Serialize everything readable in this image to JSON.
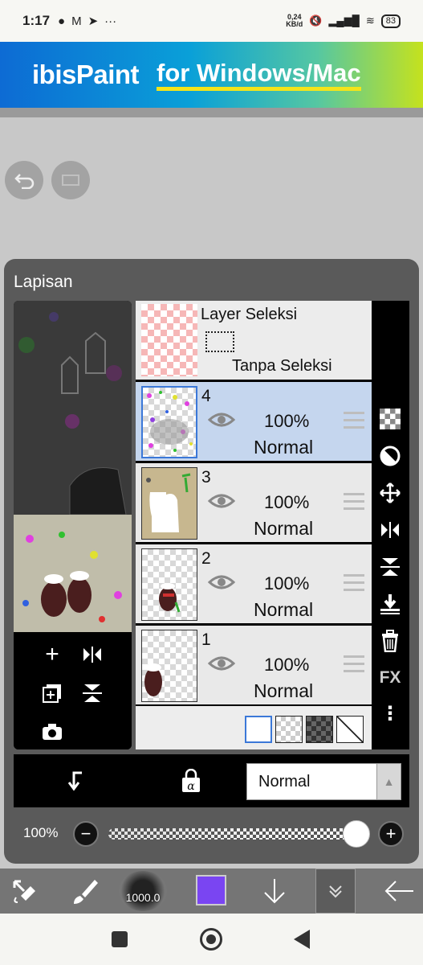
{
  "status_bar": {
    "time": "1:17",
    "net_speed_value": "0,24",
    "net_speed_unit": "KB/d",
    "battery": "83",
    "more": "···"
  },
  "banner": {
    "logo": "ibisPaint",
    "subtitle": "for Windows/Mac"
  },
  "layer_panel": {
    "title": "Lapisan",
    "selection_layer": {
      "title": "Layer Seleksi",
      "status": "Tanpa Seleksi"
    },
    "layers": [
      {
        "number": "4",
        "opacity": "100%",
        "blend": "Normal",
        "selected": true
      },
      {
        "number": "3",
        "opacity": "100%",
        "blend": "Normal",
        "selected": false
      },
      {
        "number": "2",
        "opacity": "100%",
        "blend": "Normal",
        "selected": false
      },
      {
        "number": "1",
        "opacity": "100%",
        "blend": "Normal",
        "selected": false
      }
    ],
    "side_toolbar": {
      "fx_label": "FX",
      "more": "⋮"
    }
  },
  "blend_bar": {
    "mode": "Normal"
  },
  "opacity_control": {
    "label": "100%",
    "value": 1.0,
    "minus": "−",
    "plus": "+"
  },
  "bottom_toolbar": {
    "brush_size": "1000.0",
    "color": "#7a45f2"
  },
  "colors": {
    "selected_layer": "#c5d6ee",
    "panel_bg": "#5a5a5a"
  }
}
